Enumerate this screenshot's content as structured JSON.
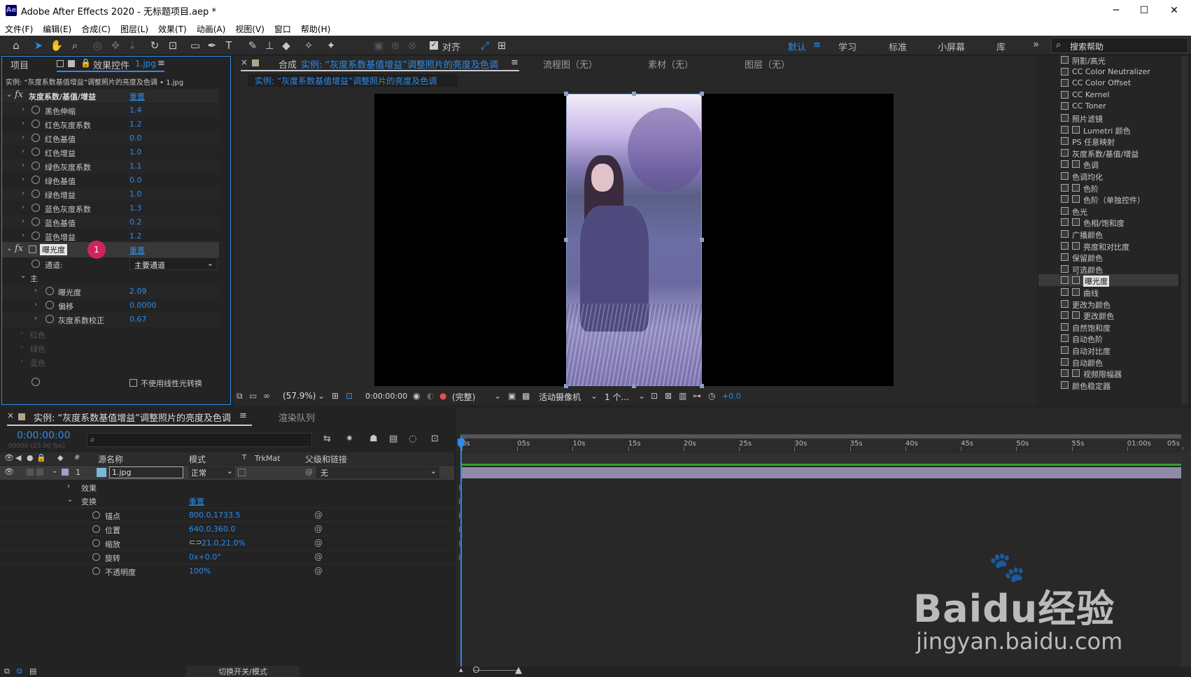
{
  "app": {
    "title": "Adobe After Effects 2020 - 无标题项目.aep *",
    "logo": "Ae",
    "min": "─",
    "max": "☐",
    "close": "✕"
  },
  "menu": [
    "文件(F)",
    "编辑(E)",
    "合成(C)",
    "图层(L)",
    "效果(T)",
    "动画(A)",
    "视图(V)",
    "窗口",
    "帮助(H)"
  ],
  "toolbar": {
    "snap_label": "对齐",
    "workspaces": [
      "默认",
      "学习",
      "标准",
      "小屏幕",
      "库"
    ],
    "active_workspace": "默认",
    "more": "»",
    "search_placeholder": "搜索帮助"
  },
  "left_panel": {
    "tab_project": "项目",
    "tab_effects": "效果控件",
    "tab_effects_file": "1.jpg",
    "breadcrumb": "实例: “灰度系数基值增益”调整照片的亮度及色调 • 1.jpg",
    "effect1_name": "灰度系数/基值/增益",
    "reset": "重置",
    "params": [
      {
        "label": "黑色伸缩",
        "value": "1.4"
      },
      {
        "label": "红色灰度系数",
        "value": "1.2"
      },
      {
        "label": "红色基值",
        "value": "0.0"
      },
      {
        "label": "红色增益",
        "value": "1.0"
      },
      {
        "label": "绿色灰度系数",
        "value": "1.1"
      },
      {
        "label": "绿色基值",
        "value": "0.0"
      },
      {
        "label": "绿色增益",
        "value": "1.0"
      },
      {
        "label": "蓝色灰度系数",
        "value": "1.3"
      },
      {
        "label": "蓝色基值",
        "value": "0.2"
      },
      {
        "label": "蓝色增益",
        "value": "1.2"
      }
    ],
    "effect2_name": "曝光度",
    "badge": "1",
    "channel_label": "通道:",
    "channel_value": "主要通道",
    "main_group": "主",
    "main_params": [
      {
        "label": "曝光度",
        "value": "2.09"
      },
      {
        "label": "偏移",
        "value": "0.0000"
      },
      {
        "label": "灰度系数校正",
        "value": "0.67"
      }
    ],
    "color_groups": [
      "红色",
      "绿色",
      "蓝色"
    ],
    "linear_checkbox": "不使用线性光转换"
  },
  "comp_panel": {
    "tab_prefix": "合成",
    "tab_name": "实例: “灰度系数基值增益”调整照片的亮度及色调",
    "other_tabs": [
      "流程图（无）",
      "素材（无）",
      "图层（无）"
    ],
    "sub_tab": "实例: “灰度系数基值增益”调整照片的亮度及色调",
    "zoom": "(57.9%)",
    "timecode": "0:00:00:00",
    "resolution": "(完整)",
    "camera": "活动摄像机",
    "views": "1 个...",
    "exposure": "+0.0"
  },
  "effects_list": {
    "items": [
      {
        "name": "阴影/高光",
        "two": false
      },
      {
        "name": "CC Color Neutralizer",
        "two": false
      },
      {
        "name": "CC Color Offset",
        "two": false
      },
      {
        "name": "CC Kernel",
        "two": false
      },
      {
        "name": "CC Toner",
        "two": false
      },
      {
        "name": "照片滤镜",
        "two": false
      },
      {
        "name": "Lumetri 颜色",
        "two": true
      },
      {
        "name": "PS 任意映射",
        "two": false
      },
      {
        "name": "灰度系数/基值/增益",
        "two": false
      },
      {
        "name": "色调",
        "two": true
      },
      {
        "name": "色调均化",
        "two": false
      },
      {
        "name": "色阶",
        "two": true
      },
      {
        "name": "色阶（单独控件）",
        "two": true
      },
      {
        "name": "色光",
        "two": false
      },
      {
        "name": "色相/饱和度",
        "two": true
      },
      {
        "name": "广播颜色",
        "two": false
      },
      {
        "name": "亮度和对比度",
        "two": true
      },
      {
        "name": "保留颜色",
        "two": false
      },
      {
        "name": "可选颜色",
        "two": false
      },
      {
        "name": "曝光度",
        "two": true,
        "selected": true
      },
      {
        "name": "曲线",
        "two": true
      },
      {
        "name": "更改为颜色",
        "two": false
      },
      {
        "name": "更改颜色",
        "two": true
      },
      {
        "name": "自然饱和度",
        "two": false
      },
      {
        "name": "自动色阶",
        "two": false
      },
      {
        "name": "自动对比度",
        "two": false
      },
      {
        "name": "自动颜色",
        "two": false
      },
      {
        "name": "视频限幅器",
        "two": true
      },
      {
        "name": "颜色稳定器",
        "two": false
      }
    ]
  },
  "timeline": {
    "tab_name": "实例: “灰度系数基值增益”调整照片的亮度及色调",
    "render_queue": "渲染队列",
    "timecode": "0:00:00:00",
    "timecode_sub": "00000 (25.00 fps)",
    "search_placeholder": "",
    "col_num": "#",
    "col_source": "源名称",
    "col_mode": "模式",
    "col_t": "T",
    "col_trkmat": "TrkMat",
    "col_parent": "父级和链接",
    "layer_num": "1",
    "layer_name": "1.jpg",
    "layer_mode": "正常",
    "layer_parent": "无",
    "effects_group": "效果",
    "transform_group": "变换",
    "reset": "重置",
    "props": [
      {
        "label": "锚点",
        "value": "800.0,1733.5"
      },
      {
        "label": "位置",
        "value": "640.0,360.0"
      },
      {
        "label": "缩放",
        "value": "21.0,21.0%"
      },
      {
        "label": "旋转",
        "value": "0x+0.0°"
      },
      {
        "label": "不透明度",
        "value": "100%"
      }
    ],
    "ruler": [
      "0s",
      "05s",
      "10s",
      "15s",
      "20s",
      "25s",
      "30s",
      "35s",
      "40s",
      "45s",
      "50s",
      "55s",
      "01:00s",
      "05s"
    ],
    "toggle_label": "切换开关/模式"
  },
  "watermark": {
    "brand": "Baidu经验",
    "url": "jingyan.baidu.com"
  },
  "colors": {
    "accent": "#2d8ceb",
    "badge": "#d0245e",
    "layer_bar": "#8e8aa8"
  }
}
